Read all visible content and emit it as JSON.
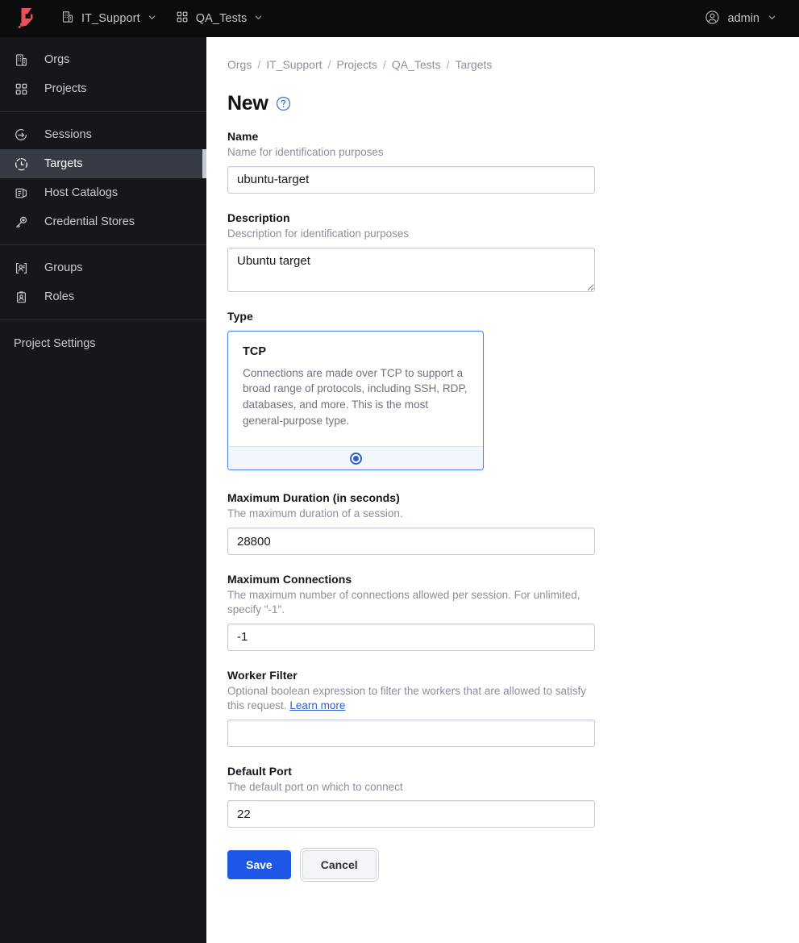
{
  "topbar": {
    "logo_name": "boundary-logo",
    "org": {
      "label": "IT_Support",
      "icon": "building-icon",
      "chevron": "⌄"
    },
    "project": {
      "label": "QA_Tests",
      "icon": "grid-icon",
      "chevron": "⌄"
    },
    "user": {
      "label": "admin",
      "icon": "user-circle-icon",
      "chevron": "⌄"
    }
  },
  "sidebar": {
    "groups": [
      {
        "items": [
          {
            "label": "Orgs",
            "icon": "building-icon",
            "active": false
          },
          {
            "label": "Projects",
            "icon": "grid-icon",
            "active": false
          }
        ]
      },
      {
        "items": [
          {
            "label": "Sessions",
            "icon": "session-arrow-icon",
            "active": false
          },
          {
            "label": "Targets",
            "icon": "target-icon",
            "active": true
          },
          {
            "label": "Host Catalogs",
            "icon": "host-catalog-icon",
            "active": false
          },
          {
            "label": "Credential Stores",
            "icon": "key-icon",
            "active": false
          }
        ]
      },
      {
        "items": [
          {
            "label": "Groups",
            "icon": "groups-icon",
            "active": false
          },
          {
            "label": "Roles",
            "icon": "roles-icon",
            "active": false
          }
        ]
      },
      {
        "items": [
          {
            "label": "Project Settings",
            "icon": "",
            "active": false
          }
        ]
      }
    ]
  },
  "breadcrumb": {
    "items": [
      "Orgs",
      "IT_Support",
      "Projects",
      "QA_Tests",
      "Targets"
    ],
    "separator": "/"
  },
  "page": {
    "title": "New",
    "help_icon": "help-circle-icon"
  },
  "form": {
    "name": {
      "label": "Name",
      "help": "Name for identification purposes",
      "value": "ubuntu-target",
      "placeholder": "Name"
    },
    "description": {
      "label": "Description",
      "help": "Description for identification purposes",
      "value": "Ubuntu target",
      "placeholder": "Description"
    },
    "type": {
      "label": "Type",
      "cards": [
        {
          "title": "TCP",
          "description": "Connections are made over TCP to support a broad range of protocols, including SSH, RDP, databases, and more. This is the most general-purpose type.",
          "selected": true
        }
      ]
    },
    "max_duration": {
      "label": "Maximum Duration (in seconds)",
      "help": "The maximum duration of a session.",
      "value": "28800",
      "placeholder": ""
    },
    "max_connections": {
      "label": "Maximum Connections",
      "help": "The maximum number of connections allowed per session. For unlimited, specify \"-1\".",
      "value": "-1",
      "placeholder": ""
    },
    "worker_filter": {
      "label": "Worker Filter",
      "help_before": "Optional boolean expression to filter the workers that are allowed to satisfy this request.",
      "help_link": "Learn more",
      "value": "",
      "placeholder": ""
    },
    "default_port": {
      "label": "Default Port",
      "help": "The default port on which to connect",
      "value": "22",
      "placeholder": ""
    },
    "actions": {
      "save_label": "Save",
      "cancel_label": "Cancel"
    }
  },
  "colors": {
    "brand_red": "#e8505b",
    "topbar_bg": "#0b0c0e",
    "sidebar_bg": "#15171a",
    "sidebar_active_bg": "#363b45",
    "accent_blue": "#1c57e8",
    "link_blue": "#2b5fd9"
  }
}
